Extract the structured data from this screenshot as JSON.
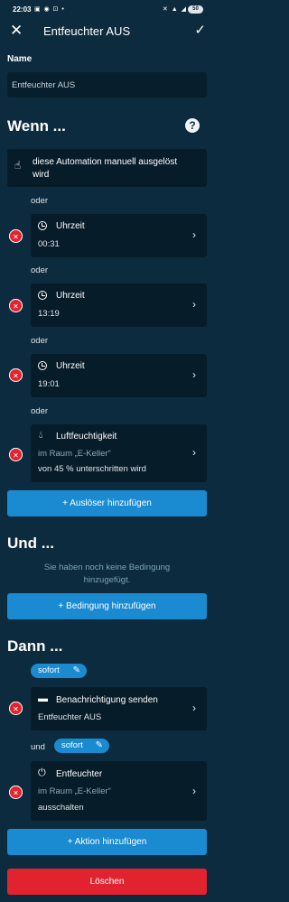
{
  "statusbar": {
    "time": "22:03",
    "left_icons": "▣ ◉ ⊡ •",
    "right_icons": "✕ ▲ ◢",
    "battery": "50"
  },
  "appbar": {
    "title": "Entfeuchter AUS"
  },
  "name": {
    "label": "Name",
    "value": "Entfeuchter AUS"
  },
  "wenn": {
    "heading": "Wenn ...",
    "manual_trigger": "diese Automation manuell ausgelöst wird",
    "connector": "oder",
    "triggers": [
      {
        "title": "Uhrzeit",
        "value": "00:31"
      },
      {
        "title": "Uhrzeit",
        "value": "13:19"
      },
      {
        "title": "Uhrzeit",
        "value": "19:01"
      }
    ],
    "humidity": {
      "title": "Luftfeuchtigkeit",
      "room": "im Raum „E-Keller“",
      "condition": "von 45 % unterschritten wird"
    },
    "add_trigger": "+ Auslöser hinzufügen"
  },
  "und": {
    "heading": "Und ...",
    "empty_text": "Sie haben noch keine Bedingung hinzugefügt.",
    "add_condition": "+ Bedingung hinzufügen"
  },
  "dann": {
    "heading": "Dann ...",
    "timing": "sofort",
    "connector": "und",
    "action1": {
      "title": "Benachrichtigung senden",
      "detail": "Entfeuchter AUS"
    },
    "action2": {
      "title": "Entfeuchter",
      "room": "im Raum „E-Keller“",
      "detail": "ausschalten"
    },
    "add_action": "+ Aktion hinzufügen"
  },
  "delete_button": "Löschen",
  "colors": {
    "background": "#0d2b3e",
    "card": "#071c29",
    "primary": "#1a8ad1",
    "danger": "#e0232f"
  }
}
